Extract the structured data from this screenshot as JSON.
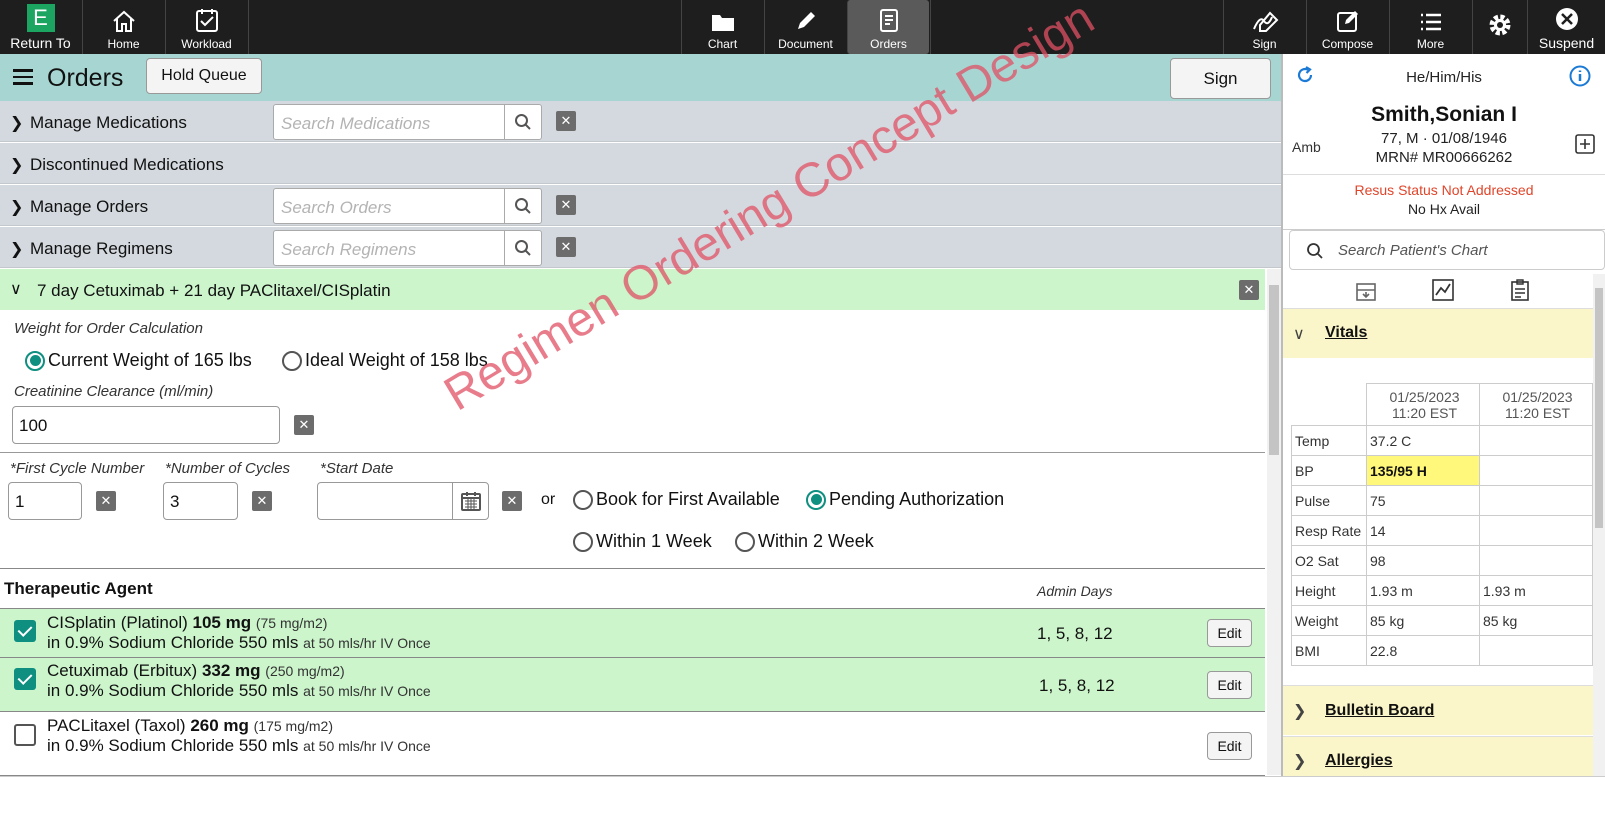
{
  "toolbar": {
    "return_to": "Return To",
    "home": "Home",
    "workload": "Workload",
    "chart": "Chart",
    "document": "Document",
    "orders": "Orders",
    "sign": "Sign",
    "compose": "Compose",
    "more": "More",
    "suspend": "Suspend",
    "logo_letter": "E"
  },
  "header": {
    "title": "Orders",
    "hold_queue": "Hold Queue",
    "sign": "Sign"
  },
  "managers": [
    {
      "label": "Manage Medications",
      "placeholder": "Search Medications"
    },
    {
      "label": "Discontinued Medications"
    },
    {
      "label": "Manage Orders",
      "placeholder": "Search Orders"
    },
    {
      "label": "Manage Regimens",
      "placeholder": "Search Regimens"
    }
  ],
  "regimen": {
    "title": "7 day Cetuximab + 21 day PAClitaxel/CISplatin",
    "weight_label": "Weight for Order Calculation",
    "weight_current": "Current Weight of 165 lbs",
    "weight_ideal": "Ideal Weight of 158 lbs",
    "weight_selected": "current",
    "creatinine_label": "Creatinine Clearance (ml/min)",
    "creatinine_value": "100",
    "first_cycle_label": "*First Cycle Number",
    "first_cycle_value": "1",
    "num_cycles_label": "*Number of Cycles",
    "num_cycles_value": "3",
    "start_date_label": "*Start Date",
    "start_date_value": "",
    "or_text": "or",
    "opt_book_first": "Book for First Available",
    "opt_pending": "Pending Authorization",
    "opt_within1": "Within 1 Week",
    "opt_within2": "Within 2 Week",
    "selected_option": "pending"
  },
  "agents": {
    "col_agent": "Therapeutic Agent",
    "col_days": "Admin Days",
    "edit_label": "Edit",
    "rows": [
      {
        "checked": true,
        "name": "CISplatin (Platinol)",
        "dose": "105 mg",
        "per": "(75 mg/m2)",
        "diluent": "in 0.9% Sodium Chloride 550 mls",
        "rate": "at 50 mls/hr IV Once",
        "days": "1, 5, 8, 12"
      },
      {
        "checked": true,
        "name": "Cetuximab (Erbitux)",
        "dose": "332 mg",
        "per": "(250 mg/m2)",
        "diluent": "in 0.9% Sodium Chloride 550 mls",
        "rate": "at 50 mls/hr IV Once",
        "days": "1, 5, 8, 12"
      },
      {
        "checked": false,
        "name": "PACLitaxel (Taxol)",
        "dose": "260 mg",
        "per": "(175 mg/m2)",
        "diluent": "in 0.9% Sodium Chloride 550 mls",
        "rate": "at 50 mls/hr IV Once",
        "days": ""
      }
    ]
  },
  "watermark": "Regimen Ordering Concept Design",
  "patient": {
    "pronouns": "He/Him/His",
    "name": "Smith,Sonian I",
    "age_sex_dob": "77, M · 01/08/1946",
    "mrn": "MRN# MR00666262",
    "encounter": "Amb",
    "resus": "Resus Status Not Addressed",
    "hx": "No Hx Avail",
    "search_placeholder": "Search Patient's Chart"
  },
  "vitals": {
    "title": "Vitals",
    "col1_date": "01/25/2023",
    "col1_time": "11:20 EST",
    "col2_date": "01/25/2023",
    "col2_time": "11:20 EST",
    "rows": [
      {
        "label": "Temp",
        "v1": "37.2 C",
        "v2": ""
      },
      {
        "label": "BP",
        "v1": "135/95 H",
        "v2": ""
      },
      {
        "label": "Pulse",
        "v1": "75",
        "v2": ""
      },
      {
        "label": "Resp Rate",
        "v1": "14",
        "v2": ""
      },
      {
        "label": "O2 Sat",
        "v1": "98",
        "v2": ""
      },
      {
        "label": "Height",
        "v1": "1.93 m",
        "v2": "1.93 m"
      },
      {
        "label": "Weight",
        "v1": "85 kg",
        "v2": "85 kg"
      },
      {
        "label": "BMI",
        "v1": "22.8",
        "v2": ""
      }
    ]
  },
  "sections": {
    "bulletin": "Bulletin Board",
    "allergies": "Allergies"
  },
  "colors": {
    "toolbar": "#1e1e1e",
    "header_teal": "#a7d6d2",
    "manager_gray": "#d3d9de",
    "regimen_green": "#ccf5cc",
    "accent_teal": "#0e8f80",
    "watermark": "#e05064",
    "resus_red": "#e0452a",
    "section_yellow": "#fbf6c9",
    "bp_highlight": "#fff87a"
  }
}
